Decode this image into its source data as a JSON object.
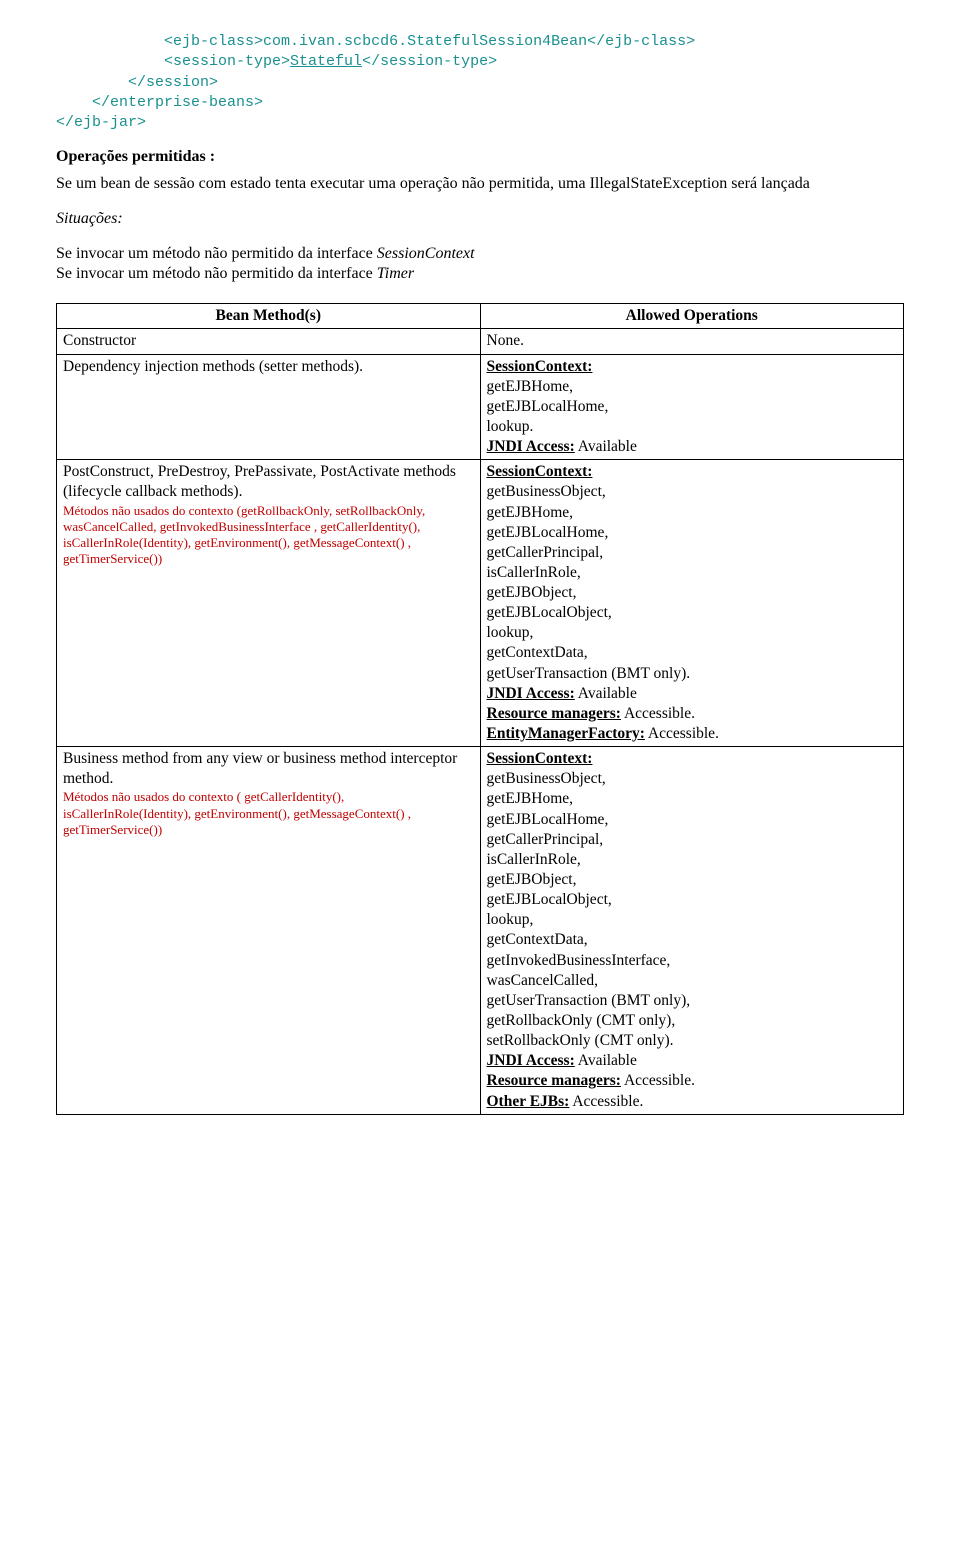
{
  "code": {
    "line1_pre": "            <ejb-class>",
    "line1_mid": "com.ivan.scbcd6.StatefulSession4Bean",
    "line1_post": "</ejb-class>",
    "line2_pre": "            <session-type>",
    "line2_mid": "Stateful",
    "line2_post": "</session-type>",
    "line3": "        </session>",
    "line4": "    </enterprise-beans>",
    "line5": "</ejb-jar>"
  },
  "headings": {
    "operacoes": "Operações permitidas :",
    "situacoes": "Situações:"
  },
  "paragraphs": {
    "p1": "Se um bean de sessão com estado tenta executar uma operação não permitida, uma IllegalStateException será lançada",
    "p2a": "Se invocar um método não permitido da interface ",
    "p2a_em": "SessionContext",
    "p2b": "Se invocar um método não permitido da interface ",
    "p2b_em": "Timer"
  },
  "table": {
    "head_left": "Bean Method(s)",
    "head_right": "Allowed Operations",
    "rows": [
      {
        "left_main": "Constructor",
        "left_red": "",
        "right_lines": [
          {
            "text": "None."
          }
        ]
      },
      {
        "left_main": "Dependency injection methods (setter methods).",
        "left_red": "",
        "right_lines": [
          {
            "label": "SessionContext:",
            "bold_underline": true
          },
          {
            "text": "getEJBHome,"
          },
          {
            "text": "getEJBLocalHome,"
          },
          {
            "text": "lookup."
          },
          {
            "label": "JNDI Access:",
            "suffix": " Available",
            "bold_underline": true
          }
        ]
      },
      {
        "left_main": "PostConstruct, PreDestroy, PrePassivate, PostActivate methods (lifecycle callback methods).",
        "left_red": "Métodos não usados do contexto\n(getRollbackOnly, setRollbackOnly, wasCancelCalled, getInvokedBusinessInterface , getCallerIdentity(), isCallerInRole(Identity),   getEnvironment(), getMessageContext() , getTimerService())",
        "right_lines": [
          {
            "label": "SessionContext:",
            "bold_underline": true
          },
          {
            "text": "getBusinessObject,"
          },
          {
            "text": "getEJBHome,"
          },
          {
            "text": "getEJBLocalHome,"
          },
          {
            "text": "getCallerPrincipal,"
          },
          {
            "text": "isCallerInRole,"
          },
          {
            "text": "getEJBObject,"
          },
          {
            "text": "getEJBLocalObject,"
          },
          {
            "text": "lookup,"
          },
          {
            "text": "getContextData,"
          },
          {
            "text": "getUserTransaction (BMT only)."
          },
          {
            "label": "JNDI Access:",
            "suffix": " Available",
            "bold_underline": true
          },
          {
            "label": "Resource managers:",
            "suffix": " Accessible.",
            "bold_underline": true
          },
          {
            "label": "EntityManagerFactory:",
            "suffix": " Accessible.",
            "bold_underline": true
          }
        ]
      },
      {
        "left_main": "Business method from any view or business method interceptor method.",
        "left_red": "Métodos não usados do contexto\n( getCallerIdentity(), isCallerInRole(Identity), getEnvironment(), getMessageContext() , getTimerService())",
        "right_lines": [
          {
            "label": "SessionContext:",
            "bold_underline": true
          },
          {
            "text": "getBusinessObject,"
          },
          {
            "text": "getEJBHome,"
          },
          {
            "text": "getEJBLocalHome,"
          },
          {
            "text": "getCallerPrincipal,"
          },
          {
            "text": "isCallerInRole,"
          },
          {
            "text": "getEJBObject,"
          },
          {
            "text": "getEJBLocalObject,"
          },
          {
            "text": "lookup,"
          },
          {
            "text": "getContextData,"
          },
          {
            "text": "getInvokedBusinessInterface,"
          },
          {
            "text": "wasCancelCalled,"
          },
          {
            "text": "getUserTransaction (BMT only),"
          },
          {
            "text": "getRollbackOnly (CMT only),"
          },
          {
            "text": "setRollbackOnly (CMT only)."
          },
          {
            "label": "JNDI Access:",
            "suffix": " Available",
            "bold_underline": true
          },
          {
            "label": "Resource managers:",
            "suffix": " Accessible.",
            "bold_underline": true
          },
          {
            "label": "Other EJBs:",
            "suffix": " Accessible.",
            "bold_underline": true
          }
        ]
      }
    ]
  }
}
